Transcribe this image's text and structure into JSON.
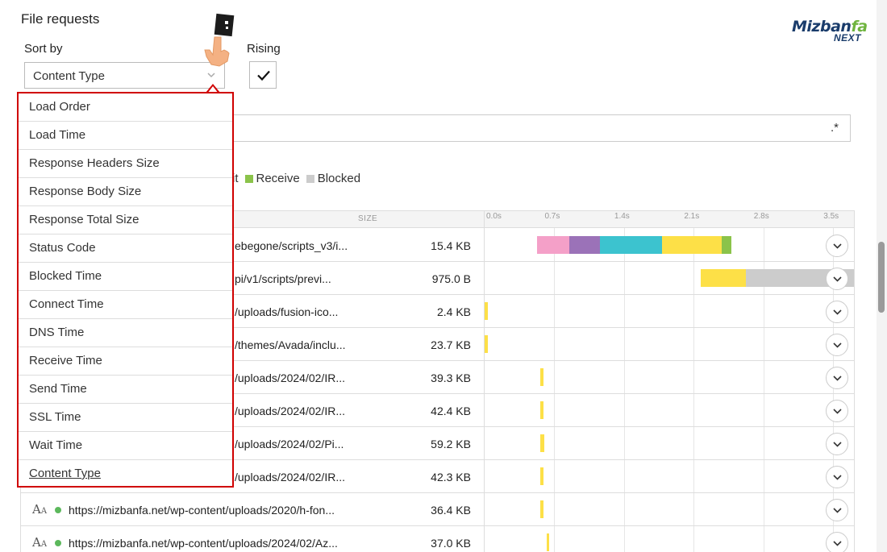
{
  "page": {
    "title": "File requests",
    "sort_label": "Sort by",
    "sort_value": "Content Type",
    "rising_label": "Rising",
    "rising_checked": true,
    "filter_regex": ".*"
  },
  "logo": {
    "line1_a": "Mizban",
    "line1_b": "fa",
    "line2": "NEXT"
  },
  "legend": [
    {
      "label": "it",
      "color": ""
    },
    {
      "label": "Receive",
      "color": "#8bc34a"
    },
    {
      "label": "Blocked",
      "color": "#cccccc"
    }
  ],
  "table": {
    "size_header": "SIZE",
    "ticks": [
      "0.0s",
      "0.7s",
      "1.4s",
      "2.1s",
      "2.8s",
      "3.5s"
    ],
    "rows": [
      {
        "url": "ebegone/scripts_v3/i...",
        "size": "15.4 KB",
        "icon": "",
        "segments": [
          {
            "start": 0.53,
            "end": 0.85,
            "color": "#f4a0c8"
          },
          {
            "start": 0.85,
            "end": 1.16,
            "color": "#9b72b8"
          },
          {
            "start": 1.16,
            "end": 1.78,
            "color": "#3cc3cf"
          },
          {
            "start": 1.78,
            "end": 2.38,
            "color": "#fde047"
          },
          {
            "start": 2.38,
            "end": 2.48,
            "color": "#8bc34a"
          }
        ]
      },
      {
        "url": "pi/v1/scripts/previ...",
        "size": "975.0 B",
        "icon": "",
        "segments": [
          {
            "start": 2.17,
            "end": 2.62,
            "color": "#fde047"
          },
          {
            "start": 2.62,
            "end": 3.75,
            "color": "#cccccc"
          }
        ]
      },
      {
        "url": "/uploads/fusion-ico...",
        "size": "2.4 KB",
        "icon": "",
        "segments": [
          {
            "start": 0.0,
            "end": 0.03,
            "color": "#fde047"
          }
        ]
      },
      {
        "url": "/themes/Avada/inclu...",
        "size": "23.7 KB",
        "icon": "",
        "segments": [
          {
            "start": 0.0,
            "end": 0.03,
            "color": "#fde047"
          }
        ]
      },
      {
        "url": "/uploads/2024/02/IR...",
        "size": "39.3 KB",
        "icon": "",
        "segments": [
          {
            "start": 0.56,
            "end": 0.59,
            "color": "#fde047"
          }
        ]
      },
      {
        "url": "/uploads/2024/02/IR...",
        "size": "42.4 KB",
        "icon": "",
        "segments": [
          {
            "start": 0.56,
            "end": 0.59,
            "color": "#fde047"
          }
        ]
      },
      {
        "url": "/uploads/2024/02/Pi...",
        "size": "59.2 KB",
        "icon": "",
        "segments": [
          {
            "start": 0.56,
            "end": 0.6,
            "color": "#fde047"
          }
        ]
      },
      {
        "url": "/uploads/2024/02/IR...",
        "size": "42.3 KB",
        "icon": "",
        "segments": [
          {
            "start": 0.56,
            "end": 0.59,
            "color": "#fde047"
          }
        ]
      },
      {
        "url": "https://mizbanfa.net/wp-content/uploads/2020/h-fon...",
        "size": "36.4 KB",
        "icon": "font",
        "segments": [
          {
            "start": 0.56,
            "end": 0.59,
            "color": "#fde047"
          }
        ]
      },
      {
        "url": "https://mizbanfa.net/wp-content/uploads/2024/02/Az...",
        "size": "37.0 KB",
        "icon": "font",
        "segments": [
          {
            "start": 0.62,
            "end": 0.65,
            "color": "#fde047"
          }
        ]
      }
    ]
  },
  "dropdown": {
    "options": [
      "Load Order",
      "Load Time",
      "Response Headers Size",
      "Response Body Size",
      "Response Total Size",
      "Status Code",
      "Blocked Time",
      "Connect Time",
      "DNS Time",
      "Receive Time",
      "Send Time",
      "SSL Time",
      "Wait Time",
      "Content Type"
    ]
  },
  "icons": {
    "select_chevron": "chevron-down-icon",
    "checkbox_mark": "checkmark-icon",
    "row_expand": "chevron-down-icon",
    "font_type": "font-type-icon",
    "pointer": "pointing-hand-icon"
  }
}
